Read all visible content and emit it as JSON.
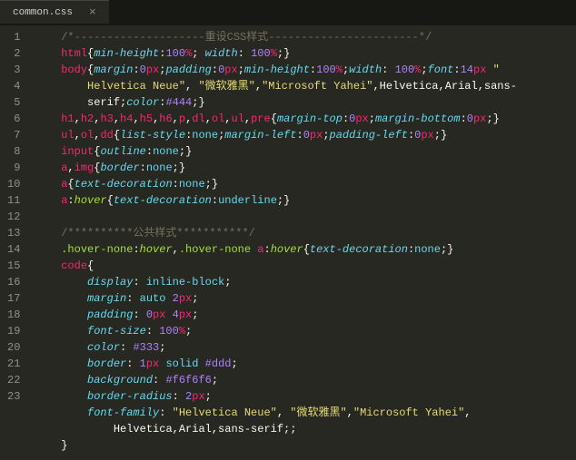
{
  "tab": {
    "filename": "common.css",
    "close": "×"
  },
  "gutter": {
    "lineCount": 23
  },
  "code": {
    "lines": [
      [
        [
          "    ",
          ""
        ],
        [
          "/*--------------------重设CSS样式-----------------------*/",
          "c-comment"
        ]
      ],
      [
        [
          "    ",
          ""
        ],
        [
          "html",
          "c-tag"
        ],
        [
          "{",
          "c-brace"
        ],
        [
          "min-height",
          "c-prop"
        ],
        [
          ":",
          "c-punct"
        ],
        [
          "100",
          "c-num"
        ],
        [
          "%",
          "c-unit"
        ],
        [
          ";",
          "c-punct"
        ],
        [
          " ",
          ""
        ],
        [
          "width",
          "c-prop"
        ],
        [
          ": ",
          "c-punct"
        ],
        [
          "100",
          "c-num"
        ],
        [
          "%",
          "c-unit"
        ],
        [
          ";}",
          "c-punct"
        ]
      ],
      [
        [
          "    ",
          ""
        ],
        [
          "body",
          "c-tag"
        ],
        [
          "{",
          "c-brace"
        ],
        [
          "margin",
          "c-prop"
        ],
        [
          ":",
          "c-punct"
        ],
        [
          "0",
          "c-num"
        ],
        [
          "px",
          "c-unit"
        ],
        [
          ";",
          "c-punct"
        ],
        [
          "padding",
          "c-prop"
        ],
        [
          ":",
          "c-punct"
        ],
        [
          "0",
          "c-num"
        ],
        [
          "px",
          "c-unit"
        ],
        [
          ";",
          "c-punct"
        ],
        [
          "min-height",
          "c-prop"
        ],
        [
          ":",
          "c-punct"
        ],
        [
          "100",
          "c-num"
        ],
        [
          "%",
          "c-unit"
        ],
        [
          ";",
          "c-punct"
        ],
        [
          "width",
          "c-prop"
        ],
        [
          ": ",
          "c-punct"
        ],
        [
          "100",
          "c-num"
        ],
        [
          "%",
          "c-unit"
        ],
        [
          ";",
          "c-punct"
        ],
        [
          "font",
          "c-prop"
        ],
        [
          ":",
          "c-punct"
        ],
        [
          "14",
          "c-num"
        ],
        [
          "px",
          "c-unit"
        ],
        [
          " ",
          ""
        ],
        [
          "\"",
          "c-str"
        ]
      ],
      [
        [
          "        ",
          ""
        ],
        [
          "Helvetica Neue\"",
          "c-str"
        ],
        [
          ", ",
          "c-punct"
        ],
        [
          "\"微软雅黑\"",
          "c-str"
        ],
        [
          ",",
          "c-punct"
        ],
        [
          "\"Microsoft Yahei\"",
          "c-str"
        ],
        [
          ",Helvetica,Arial,sans-",
          "c-punct"
        ]
      ],
      [
        [
          "        ",
          ""
        ],
        [
          "serif;",
          "c-punct"
        ],
        [
          "color",
          "c-prop"
        ],
        [
          ":",
          "c-punct"
        ],
        [
          "#444",
          "c-num"
        ],
        [
          ";}",
          "c-punct"
        ]
      ],
      [
        [
          "    ",
          ""
        ],
        [
          "h1",
          "c-tag"
        ],
        [
          ",",
          "c-punct"
        ],
        [
          "h2",
          "c-tag"
        ],
        [
          ",",
          "c-punct"
        ],
        [
          "h3",
          "c-tag"
        ],
        [
          ",",
          "c-punct"
        ],
        [
          "h4",
          "c-tag"
        ],
        [
          ",",
          "c-punct"
        ],
        [
          "h5",
          "c-tag"
        ],
        [
          ",",
          "c-punct"
        ],
        [
          "h6",
          "c-tag"
        ],
        [
          ",",
          "c-punct"
        ],
        [
          "p",
          "c-tag"
        ],
        [
          ",",
          "c-punct"
        ],
        [
          "dl",
          "c-tag"
        ],
        [
          ",",
          "c-punct"
        ],
        [
          "ol",
          "c-tag"
        ],
        [
          ",",
          "c-punct"
        ],
        [
          "ul",
          "c-tag"
        ],
        [
          ",",
          "c-punct"
        ],
        [
          "pre",
          "c-tag"
        ],
        [
          "{",
          "c-brace"
        ],
        [
          "margin-top",
          "c-prop"
        ],
        [
          ":",
          "c-punct"
        ],
        [
          "0",
          "c-num"
        ],
        [
          "px",
          "c-unit"
        ],
        [
          ";",
          "c-punct"
        ],
        [
          "margin-bottom",
          "c-prop"
        ],
        [
          ":",
          "c-punct"
        ],
        [
          "0",
          "c-num"
        ],
        [
          "px",
          "c-unit"
        ],
        [
          ";}",
          "c-punct"
        ]
      ],
      [
        [
          "    ",
          ""
        ],
        [
          "ul",
          "c-tag"
        ],
        [
          ",",
          "c-punct"
        ],
        [
          "ol",
          "c-tag"
        ],
        [
          ",",
          "c-punct"
        ],
        [
          "dd",
          "c-tag"
        ],
        [
          "{",
          "c-brace"
        ],
        [
          "list-style",
          "c-prop"
        ],
        [
          ":",
          "c-punct"
        ],
        [
          "none",
          "c-val"
        ],
        [
          ";",
          "c-punct"
        ],
        [
          "margin-left",
          "c-prop"
        ],
        [
          ":",
          "c-punct"
        ],
        [
          "0",
          "c-num"
        ],
        [
          "px",
          "c-unit"
        ],
        [
          ";",
          "c-punct"
        ],
        [
          "padding-left",
          "c-prop"
        ],
        [
          ":",
          "c-punct"
        ],
        [
          "0",
          "c-num"
        ],
        [
          "px",
          "c-unit"
        ],
        [
          ";}",
          "c-punct"
        ]
      ],
      [
        [
          "    ",
          ""
        ],
        [
          "input",
          "c-tag"
        ],
        [
          "{",
          "c-brace"
        ],
        [
          "outline",
          "c-prop"
        ],
        [
          ":",
          "c-punct"
        ],
        [
          "none",
          "c-val"
        ],
        [
          ";}",
          "c-punct"
        ]
      ],
      [
        [
          "    ",
          ""
        ],
        [
          "a",
          "c-tag"
        ],
        [
          ",",
          "c-punct"
        ],
        [
          "img",
          "c-tag"
        ],
        [
          "{",
          "c-brace"
        ],
        [
          "border",
          "c-prop"
        ],
        [
          ":",
          "c-punct"
        ],
        [
          "none",
          "c-val"
        ],
        [
          ";}",
          "c-punct"
        ]
      ],
      [
        [
          "    ",
          ""
        ],
        [
          "a",
          "c-tag"
        ],
        [
          "{",
          "c-brace"
        ],
        [
          "text-decoration",
          "c-prop"
        ],
        [
          ":",
          "c-punct"
        ],
        [
          "none",
          "c-val"
        ],
        [
          ";}",
          "c-punct"
        ]
      ],
      [
        [
          "    ",
          ""
        ],
        [
          "a",
          "c-tag"
        ],
        [
          ":",
          "c-punct"
        ],
        [
          "hover",
          "c-pseudo"
        ],
        [
          "{",
          "c-brace"
        ],
        [
          "text-decoration",
          "c-prop"
        ],
        [
          ":",
          "c-punct"
        ],
        [
          "underline",
          "c-val"
        ],
        [
          ";}",
          "c-punct"
        ]
      ],
      [
        [
          "",
          ""
        ]
      ],
      [
        [
          "    ",
          ""
        ],
        [
          "/**********公共样式***********/",
          "c-comment"
        ]
      ],
      [
        [
          "    ",
          ""
        ],
        [
          ".hover-none",
          "c-sel"
        ],
        [
          ":",
          "c-punct"
        ],
        [
          "hover",
          "c-pseudo"
        ],
        [
          ",",
          "c-punct"
        ],
        [
          ".hover-none",
          "c-sel"
        ],
        [
          " ",
          ""
        ],
        [
          "a",
          "c-tag"
        ],
        [
          ":",
          "c-punct"
        ],
        [
          "hover",
          "c-pseudo"
        ],
        [
          "{",
          "c-brace"
        ],
        [
          "text-decoration",
          "c-prop"
        ],
        [
          ":",
          "c-punct"
        ],
        [
          "none",
          "c-val"
        ],
        [
          ";}",
          "c-punct"
        ]
      ],
      [
        [
          "    ",
          ""
        ],
        [
          "code",
          "c-tag"
        ],
        [
          "{",
          "c-brace"
        ]
      ],
      [
        [
          "        ",
          ""
        ],
        [
          "display",
          "c-prop"
        ],
        [
          ": ",
          "c-punct"
        ],
        [
          "inline-block",
          "c-val"
        ],
        [
          ";",
          "c-punct"
        ]
      ],
      [
        [
          "        ",
          ""
        ],
        [
          "margin",
          "c-prop"
        ],
        [
          ": ",
          "c-punct"
        ],
        [
          "auto",
          "c-val"
        ],
        [
          " ",
          ""
        ],
        [
          "2",
          "c-num"
        ],
        [
          "px",
          "c-unit"
        ],
        [
          ";",
          "c-punct"
        ]
      ],
      [
        [
          "        ",
          ""
        ],
        [
          "padding",
          "c-prop"
        ],
        [
          ": ",
          "c-punct"
        ],
        [
          "0",
          "c-num"
        ],
        [
          "px",
          "c-unit"
        ],
        [
          " ",
          ""
        ],
        [
          "4",
          "c-num"
        ],
        [
          "px",
          "c-unit"
        ],
        [
          ";",
          "c-punct"
        ]
      ],
      [
        [
          "        ",
          ""
        ],
        [
          "font-size",
          "c-prop"
        ],
        [
          ": ",
          "c-punct"
        ],
        [
          "100",
          "c-num"
        ],
        [
          "%",
          "c-unit"
        ],
        [
          ";",
          "c-punct"
        ]
      ],
      [
        [
          "        ",
          ""
        ],
        [
          "color",
          "c-prop"
        ],
        [
          ": ",
          "c-punct"
        ],
        [
          "#333",
          "c-num"
        ],
        [
          ";",
          "c-punct"
        ]
      ],
      [
        [
          "        ",
          ""
        ],
        [
          "border",
          "c-prop"
        ],
        [
          ": ",
          "c-punct"
        ],
        [
          "1",
          "c-num"
        ],
        [
          "px",
          "c-unit"
        ],
        [
          " ",
          ""
        ],
        [
          "solid",
          "c-val"
        ],
        [
          " ",
          ""
        ],
        [
          "#ddd",
          "c-num"
        ],
        [
          ";",
          "c-punct"
        ]
      ],
      [
        [
          "        ",
          ""
        ],
        [
          "background",
          "c-prop"
        ],
        [
          ": ",
          "c-punct"
        ],
        [
          "#f6f6f6",
          "c-num"
        ],
        [
          ";",
          "c-punct"
        ]
      ],
      [
        [
          "        ",
          ""
        ],
        [
          "border-radius",
          "c-prop"
        ],
        [
          ": ",
          "c-punct"
        ],
        [
          "2",
          "c-num"
        ],
        [
          "px",
          "c-unit"
        ],
        [
          ";",
          "c-punct"
        ]
      ],
      [
        [
          "        ",
          ""
        ],
        [
          "font-family",
          "c-prop"
        ],
        [
          ": ",
          "c-punct"
        ],
        [
          "\"Helvetica Neue\"",
          "c-str"
        ],
        [
          ", ",
          "c-punct"
        ],
        [
          "\"微软雅黑\"",
          "c-str"
        ],
        [
          ",",
          "c-punct"
        ],
        [
          "\"Microsoft Yahei\"",
          "c-str"
        ],
        [
          ",",
          "c-punct"
        ]
      ],
      [
        [
          "            ",
          ""
        ],
        [
          "Helvetica,Arial,sans-serif;;",
          "c-punct"
        ]
      ],
      [
        [
          "    ",
          ""
        ],
        [
          "}",
          "c-brace"
        ]
      ]
    ],
    "lineMap": [
      1,
      2,
      3,
      3,
      3,
      4,
      5,
      6,
      7,
      8,
      9,
      10,
      11,
      12,
      13,
      14,
      15,
      16,
      17,
      18,
      19,
      20,
      21,
      22,
      22,
      23
    ]
  }
}
